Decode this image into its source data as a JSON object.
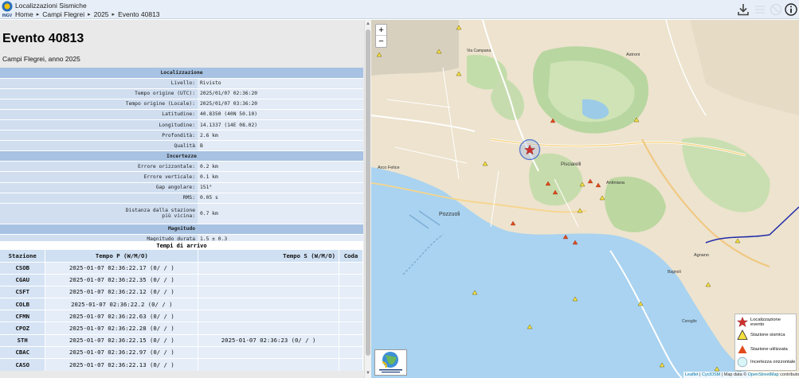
{
  "header": {
    "app_title": "Localizzazioni Sismiche",
    "breadcrumb": [
      "Home",
      "Campi Flegrei",
      "2025",
      "Evento 40813"
    ],
    "logo_text": "INGV",
    "icons": [
      "download-icon",
      "list-icon",
      "hide-icon",
      "info-icon"
    ]
  },
  "event": {
    "title": "Evento 40813",
    "subtitle": "Campi Flegrei, anno 2025"
  },
  "info_table": [
    {
      "type": "section",
      "label": "Localizzazione"
    },
    {
      "type": "row",
      "label": "Livello:",
      "value": "Rivisto"
    },
    {
      "type": "row",
      "label": "Tempo origine (UTC):",
      "value": "2025/01/07 02:36:20"
    },
    {
      "type": "row",
      "label": "Tempo origine (Locale):",
      "value": "2025/01/07 03:36:20"
    },
    {
      "type": "row",
      "label": "Latitudine:",
      "value": "40.8350 (40N 50.10)"
    },
    {
      "type": "row",
      "label": "Longitudine:",
      "value": "14.1337 (14E 08.02)"
    },
    {
      "type": "row",
      "label": "Profondità:",
      "value": "2.6 km"
    },
    {
      "type": "row",
      "label": "Qualità",
      "value": "B"
    },
    {
      "type": "section",
      "label": "Incertezze"
    },
    {
      "type": "row",
      "label": "Errore orizzontale:",
      "value": "0.2 km"
    },
    {
      "type": "row",
      "label": "Errore verticale:",
      "value": "0.1 km"
    },
    {
      "type": "row",
      "label": "Gap angolare:",
      "value": "151°"
    },
    {
      "type": "row",
      "label": "RMS:",
      "value": "0.05 s"
    },
    {
      "type": "row2",
      "label": "Distanza dalla stazione",
      "label2": "più vicina:",
      "value": "0.7 km"
    },
    {
      "type": "section",
      "label": "Magnitudo"
    },
    {
      "type": "row",
      "label": "Magnitudo durata",
      "value": "1.5 ± 0.3"
    }
  ],
  "arrivals": {
    "title": "Tempi di arrivo",
    "columns": [
      "Stazione",
      "Tempo P (W/M/O)",
      "Tempo S (W/M/O)",
      "Coda"
    ],
    "rows": [
      {
        "station": "CSOB",
        "p": "2025-01-07 02:36:22.17 (0/ / )",
        "s": ""
      },
      {
        "station": "CGAU",
        "p": "2025-01-07 02:36:22.35 (0/ / )",
        "s": ""
      },
      {
        "station": "CSFT",
        "p": "2025-01-07 02:36:22.12 (0/ / )",
        "s": ""
      },
      {
        "station": "COLB",
        "p": "2025-01-07 02:36:22.2 (0/ / )",
        "s": ""
      },
      {
        "station": "CFMN",
        "p": "2025-01-07 02:36:22.63 (0/ / )",
        "s": ""
      },
      {
        "station": "CPOZ",
        "p": "2025-01-07 02:36:22.28 (0/ / )",
        "s": ""
      },
      {
        "station": "STH",
        "p": "2025-01-07 02:36:22.15 (0/ / )",
        "s": "2025-01-07 02:36:23 (0/ / )"
      },
      {
        "station": "CBAC",
        "p": "2025-01-07 02:36:22.97 (0/ / )",
        "s": ""
      },
      {
        "station": "CASO",
        "p": "2025-01-07 02:36:22.13 (0/ / )",
        "s": ""
      }
    ]
  },
  "map": {
    "zoom_in": "+",
    "zoom_out": "−",
    "place_labels": [
      "Pozzuoli",
      "Agnano",
      "Pisciarelli",
      "Arco Felice",
      "Antiniana",
      "Via Campana",
      "Astroni",
      "Coroglio",
      "Bagnoli"
    ],
    "legend": [
      {
        "label": "Localizzazione evento",
        "icon": "star-icon"
      },
      {
        "label": "Stazione sismica",
        "icon": "yellow-triangle-icon"
      },
      {
        "label": "Stazione utilizzata",
        "icon": "red-triangle-icon"
      },
      {
        "label": "Incertezza orizzontale",
        "icon": "circle-icon"
      }
    ],
    "attribution": {
      "leaflet": "Leaflet",
      "sep": " | ",
      "cyclosm": "CyclOSM",
      "data": " | Map data © ",
      "osm": "OpenStreetMap",
      "contrib": " contributors"
    },
    "colors": {
      "sea": "#a9d3f0",
      "land": "#ede3ce",
      "event": "#d0312d",
      "station_used": "#e04a1a",
      "station": "#f5e040"
    }
  }
}
